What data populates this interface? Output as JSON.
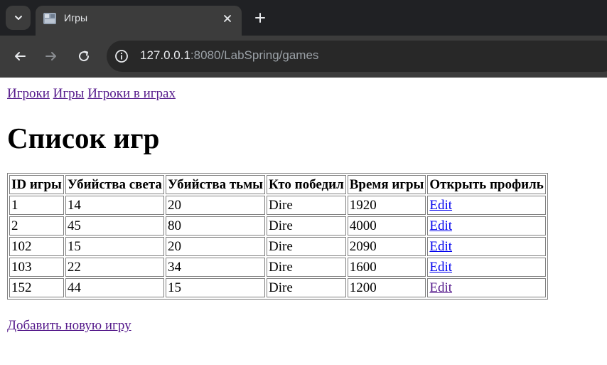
{
  "browser": {
    "tab": {
      "title": "Игры"
    },
    "url": {
      "host": "127.0.0.1",
      "rest": ":8080/LabSpring/games"
    },
    "colors": {
      "chrome_dark": "#202124",
      "toolbar": "#3c3c3c",
      "omnibox": "#282828"
    }
  },
  "nav": {
    "links": [
      "Игроки",
      "Игры",
      "Игроки в играх"
    ]
  },
  "page": {
    "title": "Список игр",
    "add_link": "Добавить новую игру"
  },
  "table": {
    "headers": [
      "ID игры",
      "Убийства света",
      "Убийства тьмы",
      "Кто победил",
      "Время игры",
      "Открыть профиль"
    ],
    "rows": [
      {
        "id": "1",
        "light": "14",
        "dark": "20",
        "winner": "Dire",
        "time": "1920",
        "edit": "Edit",
        "visited": false
      },
      {
        "id": "2",
        "light": "45",
        "dark": "80",
        "winner": "Dire",
        "time": "4000",
        "edit": "Edit",
        "visited": false
      },
      {
        "id": "102",
        "light": "15",
        "dark": "20",
        "winner": "Dire",
        "time": "2090",
        "edit": "Edit",
        "visited": false
      },
      {
        "id": "103",
        "light": "22",
        "dark": "34",
        "winner": "Dire",
        "time": "1600",
        "edit": "Edit",
        "visited": false
      },
      {
        "id": "152",
        "light": "44",
        "dark": "15",
        "winner": "Dire",
        "time": "1200",
        "edit": "Edit",
        "visited": true
      }
    ]
  },
  "link_colors": {
    "unvisited": "#0000ee",
    "visited": "#551a8b"
  }
}
